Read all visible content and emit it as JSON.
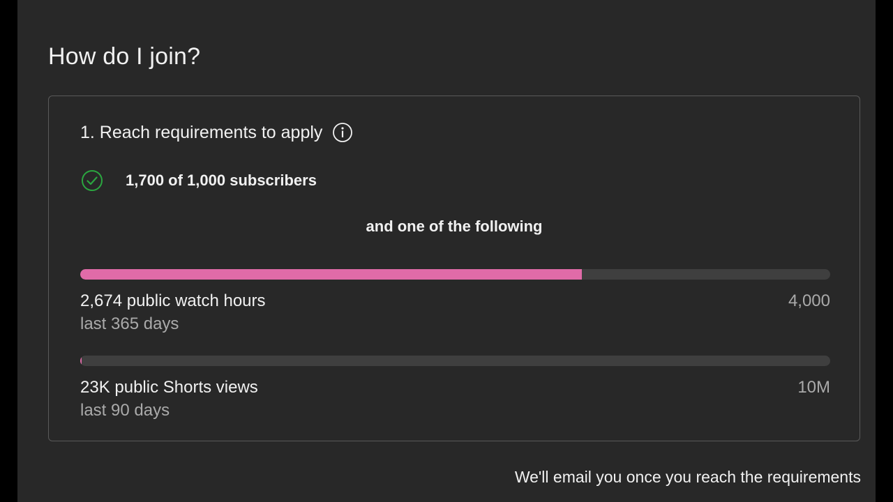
{
  "page": {
    "title": "How do I join?"
  },
  "requirements": {
    "heading": "1. Reach requirements to apply",
    "info_icon": "info-circle-icon",
    "subscribers": {
      "icon": "check-circle-icon",
      "text": "1,700 of 1,000 subscribers",
      "met": true
    },
    "separator_text": "and one of the following",
    "watch_hours": {
      "label": "2,674 public watch hours",
      "period": "last 365 days",
      "target": "4,000",
      "progress": 0.6685
    },
    "shorts_views": {
      "label": "23K public Shorts views",
      "period": "last 90 days",
      "target": "10M",
      "progress": 0.0023
    }
  },
  "footer": {
    "note": "We'll email you once you reach the requirements"
  },
  "colors": {
    "background": "#282828",
    "progress_fill": "#e06ba8",
    "progress_track": "#3f3f3f",
    "check_green": "#2ba640",
    "text_primary": "#f1f1f1",
    "text_secondary": "#aaaaaa"
  }
}
